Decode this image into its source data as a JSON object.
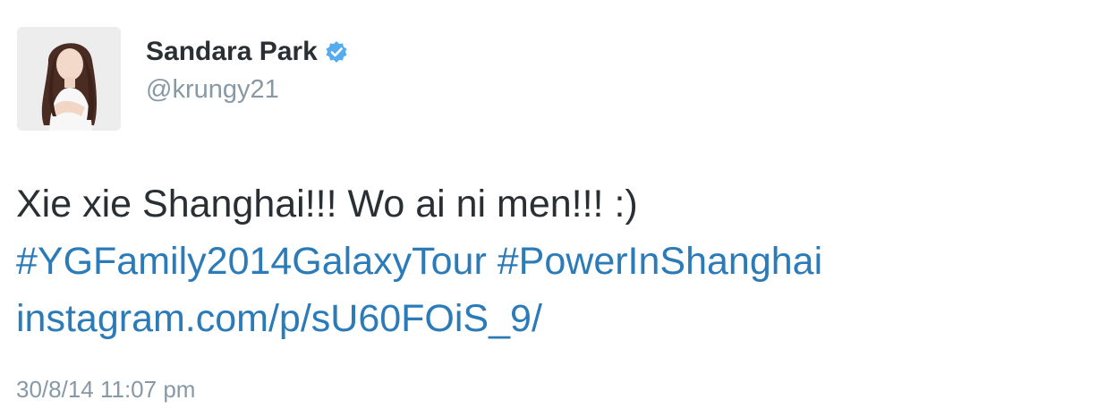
{
  "tweet": {
    "author": {
      "display_name": "Sandara Park",
      "handle": "@krungy21",
      "verified": true,
      "verified_icon": "verified-badge-icon"
    },
    "text": {
      "line1": "Xie xie Shanghai!!! Wo ai ni men!!! :)",
      "hashtag1": "#YGFamily2014GalaxyTour",
      "hashtag2": "#PowerInShanghai",
      "link": "instagram.com/p/sU60FOiS_9/"
    },
    "timestamp": "30/8/14 11:07 pm"
  },
  "colors": {
    "text": "#292f33",
    "secondary": "#8899a6",
    "link": "#2b7bb9",
    "verified": "#55acee"
  }
}
